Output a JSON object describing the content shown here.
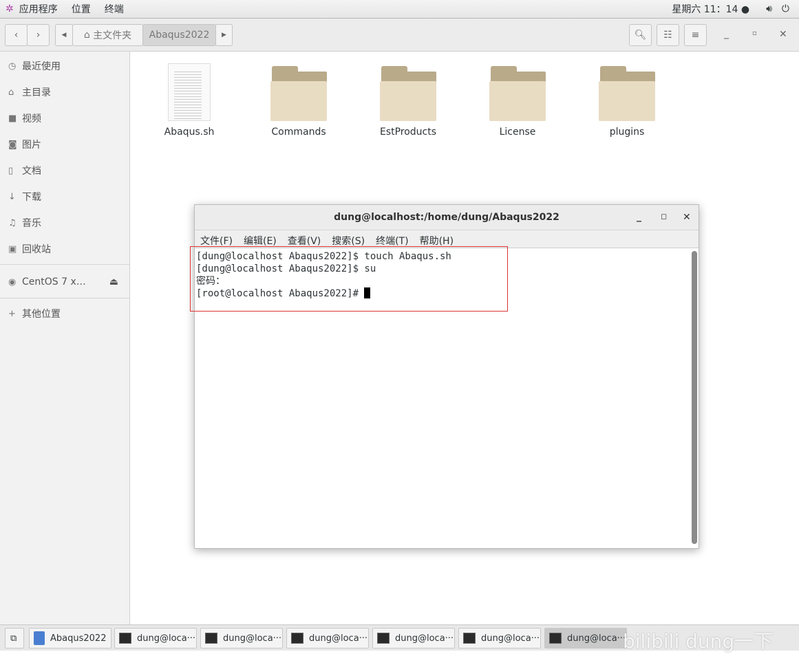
{
  "topbar": {
    "menus": [
      "应用程序",
      "位置",
      "终端"
    ],
    "clock": "星期六 11：14 ●",
    "icons": [
      "app-menu-icon",
      "volume-icon",
      "power-icon"
    ]
  },
  "toolbar": {
    "path": [
      "主文件夹",
      "Abaqus2022"
    ]
  },
  "sidebar": {
    "items": [
      {
        "label": "最近使用",
        "icon": "clock-icon"
      },
      {
        "label": "主目录",
        "icon": "home-icon"
      },
      {
        "label": "视频",
        "icon": "video-icon"
      },
      {
        "label": "图片",
        "icon": "camera-icon"
      },
      {
        "label": "文档",
        "icon": "document-icon"
      },
      {
        "label": "下载",
        "icon": "download-icon"
      },
      {
        "label": "音乐",
        "icon": "music-icon"
      },
      {
        "label": "回收站",
        "icon": "trash-icon"
      }
    ],
    "device": "CentOS 7 x…",
    "other": "其他位置"
  },
  "files": [
    {
      "name": "Abaqus.sh",
      "type": "text"
    },
    {
      "name": "Commands",
      "type": "folder"
    },
    {
      "name": "EstProducts",
      "type": "folder"
    },
    {
      "name": "License",
      "type": "folder"
    },
    {
      "name": "plugins",
      "type": "folder"
    }
  ],
  "terminal": {
    "title": "dung@localhost:/home/dung/Abaqus2022",
    "menu": [
      "文件(F)",
      "编辑(E)",
      "查看(V)",
      "搜索(S)",
      "终端(T)",
      "帮助(H)"
    ],
    "lines": [
      "[dung@localhost Abaqus2022]$ touch Abaqus.sh",
      "[dung@localhost Abaqus2022]$ su",
      "密码：",
      "[root@localhost Abaqus2022]# "
    ]
  },
  "taskbar": {
    "items": [
      "Abaqus2022",
      "dung@loca···",
      "dung@loca···",
      "dung@loca···",
      "dung@loca···",
      "dung@loca···",
      "dung@loca···"
    ]
  },
  "watermark": "bilibili dung一下"
}
